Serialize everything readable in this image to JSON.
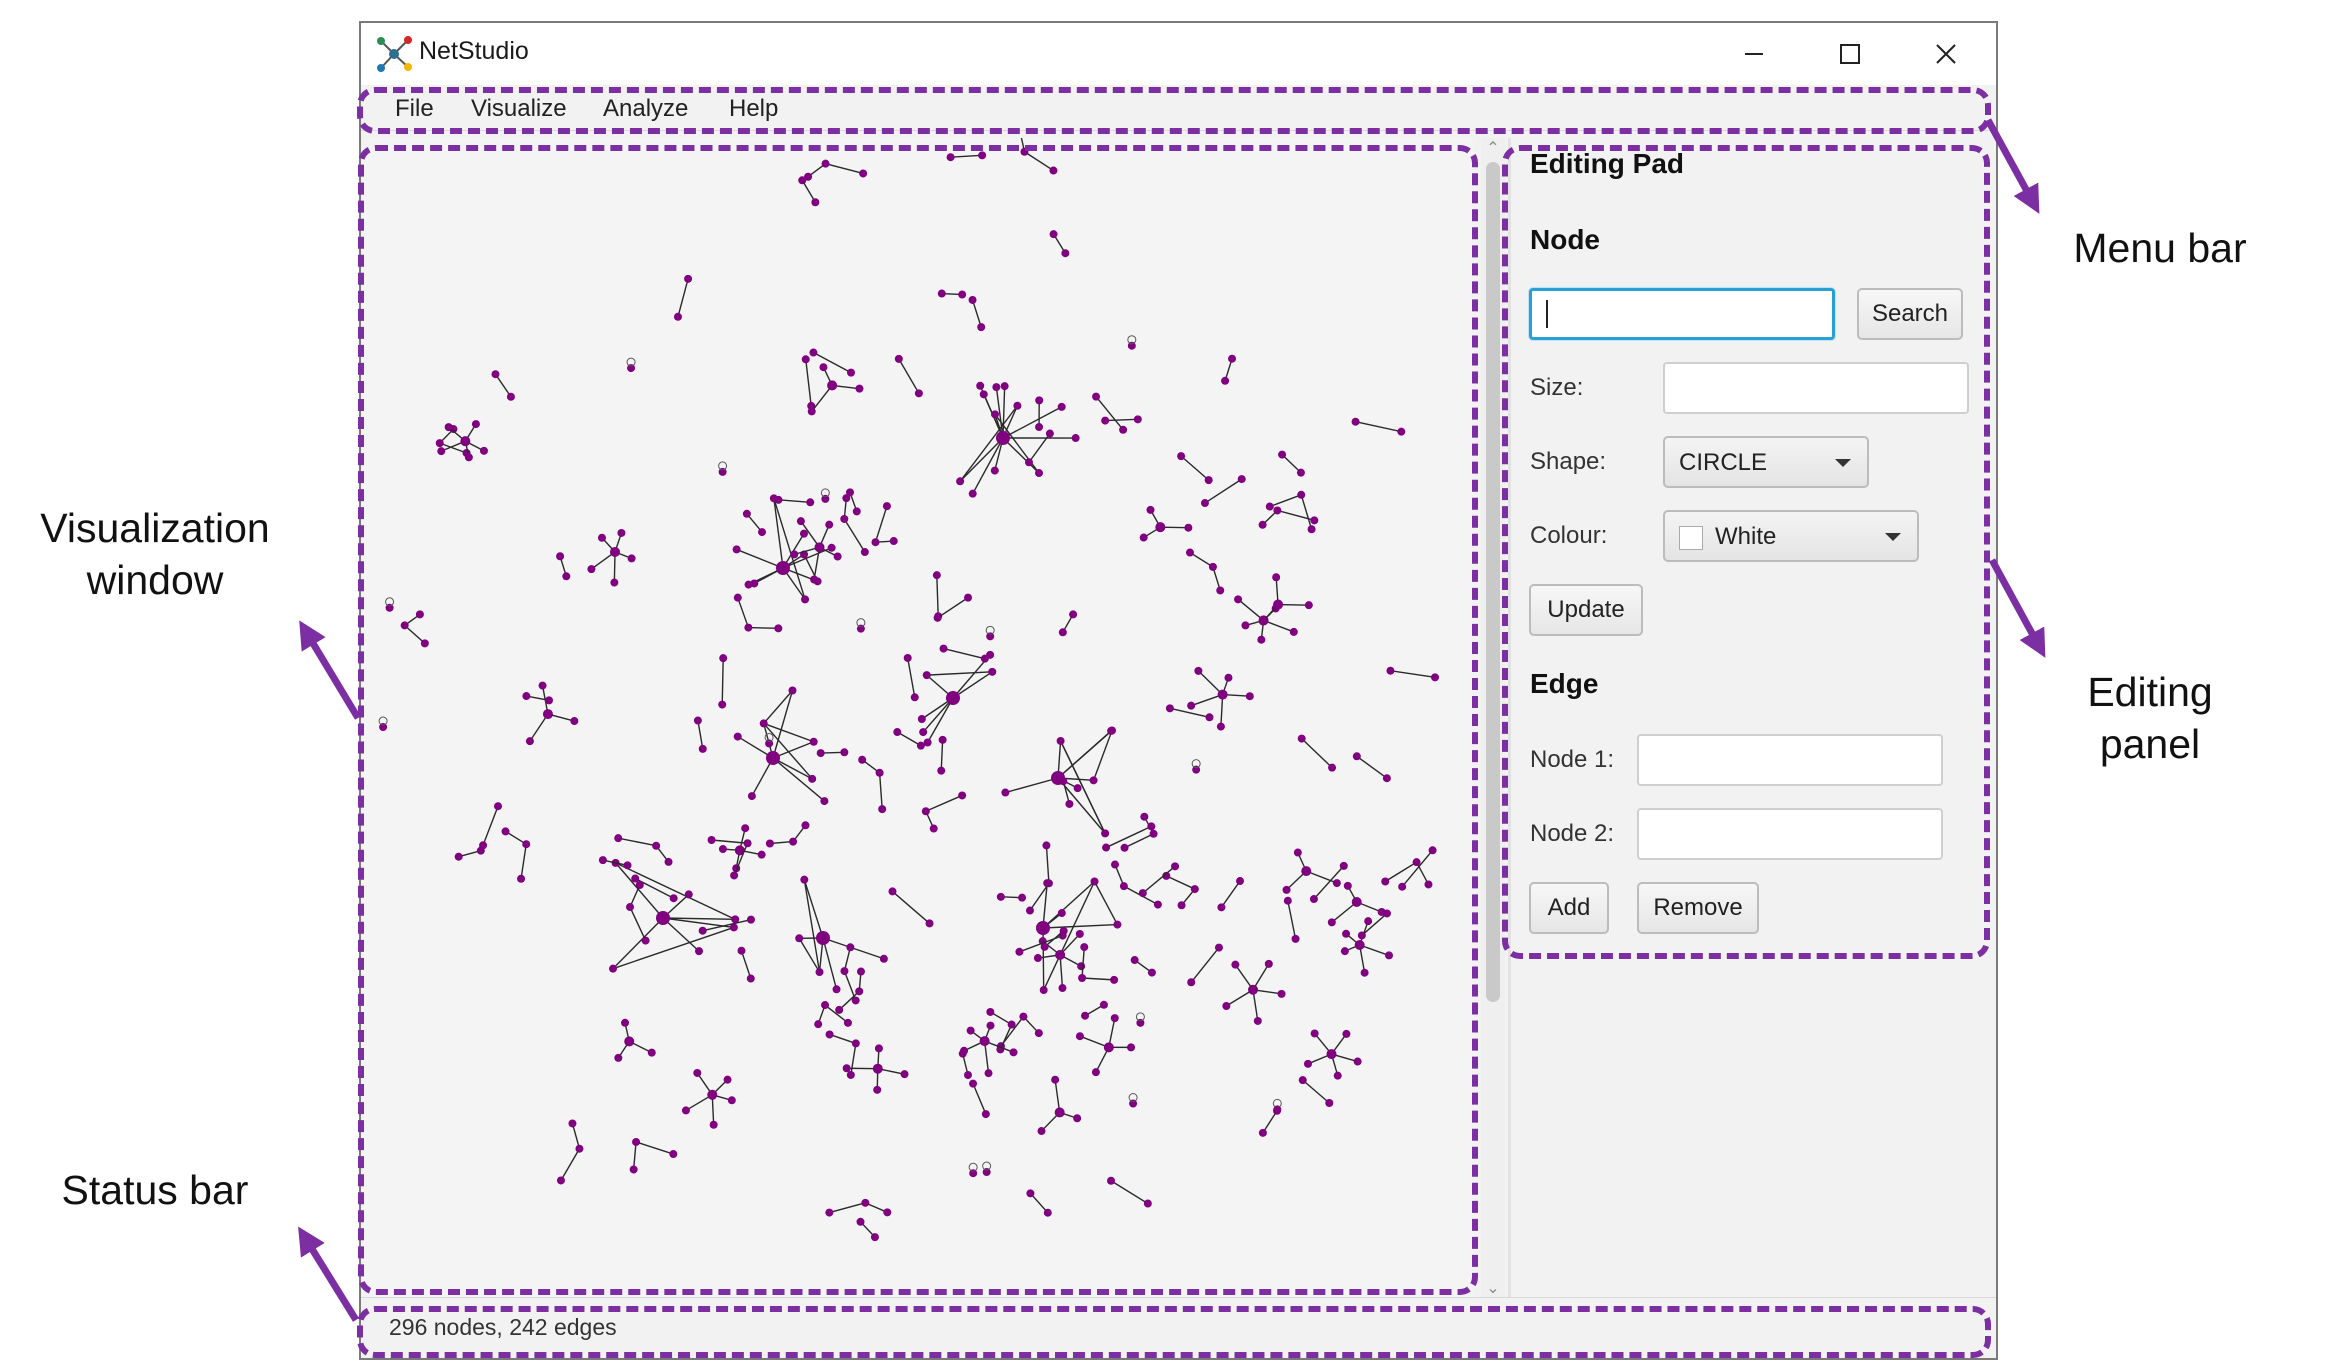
{
  "window": {
    "title": "NetStudio"
  },
  "menu": {
    "items": [
      "File",
      "Visualize",
      "Analyze",
      "Help"
    ]
  },
  "editing": {
    "title": "Editing Pad",
    "node_section": "Node",
    "search_value": "",
    "search_button": "Search",
    "size_label": "Size:",
    "size_value": "",
    "shape_label": "Shape:",
    "shape_value": "CIRCLE",
    "colour_label": "Colour:",
    "colour_value": "White",
    "update_button": "Update",
    "edge_section": "Edge",
    "node1_label": "Node 1:",
    "node1_value": "",
    "node2_label": "Node 2:",
    "node2_value": "",
    "add_button": "Add",
    "remove_button": "Remove"
  },
  "status": {
    "text": "296 nodes, 242 edges"
  },
  "callouts": {
    "menu_bar": "Menu bar",
    "visualization_window_line1": "Visualization",
    "visualization_window_line2": "window",
    "editing_panel_line1": "Editing",
    "editing_panel_line2": "panel",
    "status_bar": "Status bar"
  },
  "colors": {
    "node": "#800080",
    "accent": "#7b2fa3",
    "focus": "#2a9fd6"
  }
}
